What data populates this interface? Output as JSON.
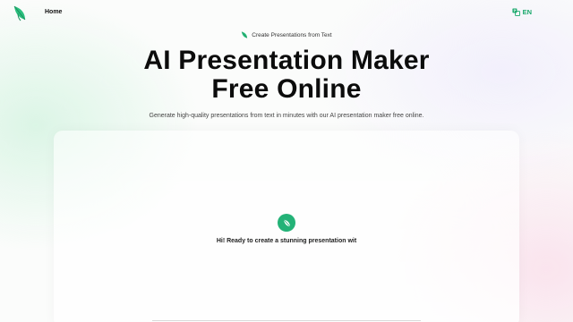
{
  "nav": {
    "logo_icon": "leaf-logo-icon",
    "home_label": "Home",
    "language_icon": "translate-icon",
    "language_label": "EN"
  },
  "hero": {
    "tag_icon": "leaf-icon",
    "tag_label": "Create Presentations from Text",
    "title_line1": "AI Presentation Maker",
    "title_line2": "Free Online",
    "subtitle": "Generate high-quality presentations from text in minutes with our AI presentation maker free online."
  },
  "chat": {
    "avatar_icon": "leaf-bot-icon",
    "greeting": "Hi! Ready to create a stunning presentation wit"
  },
  "colors": {
    "accent": "#23b277",
    "accent_text": "#18a86b"
  }
}
